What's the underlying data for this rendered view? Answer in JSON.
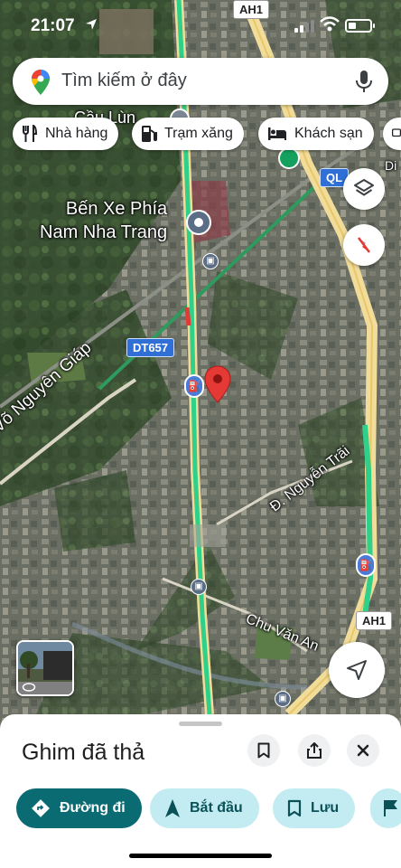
{
  "status_bar": {
    "time": "21:07"
  },
  "search": {
    "placeholder": "Tìm kiếm ở đây"
  },
  "chips": [
    {
      "label": "Nhà hàng",
      "icon": "fork-knife-icon"
    },
    {
      "label": "Trạm xăng",
      "icon": "gas-station-icon"
    },
    {
      "label": "Khách sạn",
      "icon": "bed-icon"
    }
  ],
  "map": {
    "labels": {
      "bus_station": "Bến Xe Phía\nNam Nha Trang",
      "road_vng": "g Võ Nguyên Giáp",
      "road_nt": "Đ. Nguyễn Trãi",
      "road_cva": "Chu Văn An",
      "cau": "Cầu Lùn",
      "di": "Di"
    },
    "shields": {
      "ah1_top": "AH1",
      "ql": "QL",
      "dt657": "DT657",
      "ah1_bottom": "AH1"
    },
    "colors": {
      "traffic": "#2fd08a",
      "pin": "#e53935",
      "highway": "#f1dc9a"
    }
  },
  "sheet": {
    "title": "Ghim đã thả",
    "actions": [
      {
        "label": "Đường đi",
        "icon": "directions-icon"
      },
      {
        "label": "Bắt đầu",
        "icon": "navigation-arrow-icon"
      },
      {
        "label": "Lưu",
        "icon": "bookmark-icon"
      }
    ]
  }
}
